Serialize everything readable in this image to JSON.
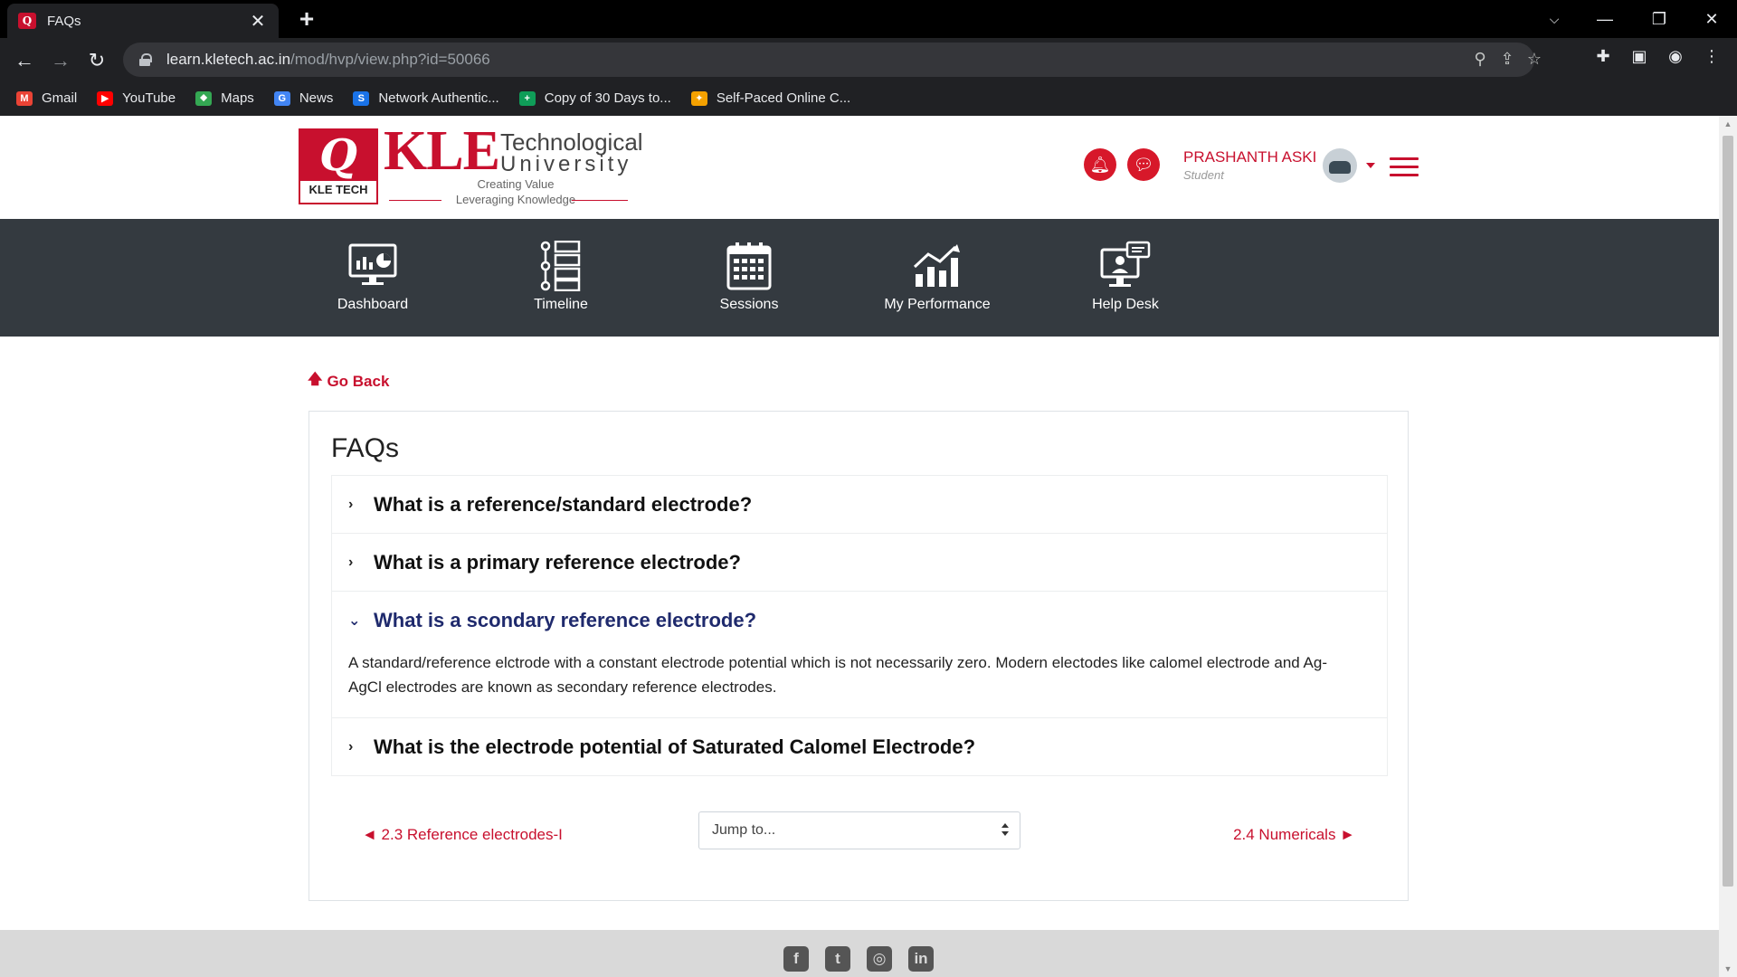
{
  "browser": {
    "tab_title": "FAQs",
    "tab_close": "✕",
    "new_tab": "+",
    "url_host": "learn.kletech.ac.in",
    "url_path": "/mod/hvp/view.php?id=50066",
    "bookmarks": [
      {
        "label": "Gmail",
        "icon": "gmail-icon",
        "color": "#ea4335"
      },
      {
        "label": "YouTube",
        "icon": "youtube-icon",
        "color": "#ff0000"
      },
      {
        "label": "Maps",
        "icon": "maps-icon",
        "color": "#34a853"
      },
      {
        "label": "News",
        "icon": "news-icon",
        "color": "#4285f4"
      },
      {
        "label": "Network Authentic...",
        "icon": "network-icon",
        "color": "#1a73e8"
      },
      {
        "label": "Copy of 30 Days to...",
        "icon": "sheets-icon",
        "color": "#0f9d58"
      },
      {
        "label": "Self-Paced Online C...",
        "icon": "course-icon",
        "color": "#f4a100"
      }
    ]
  },
  "header": {
    "logo_kle": "KLE",
    "logo_word1": "Technological",
    "logo_word2": "University",
    "logo_tag1": "Creating Value",
    "logo_tag2": "Leveraging Knowledge",
    "logo_badge": "KLE TECH",
    "user_name": "PRASHANTH ASKI",
    "user_role": "Student",
    "accent_color": "#c8102e"
  },
  "nav": {
    "items": [
      {
        "label": "Dashboard",
        "icon": "dashboard-icon"
      },
      {
        "label": "Timeline",
        "icon": "timeline-icon"
      },
      {
        "label": "Sessions",
        "icon": "calendar-icon"
      },
      {
        "label": "My Performance",
        "icon": "performance-chart-icon"
      },
      {
        "label": "Help Desk",
        "icon": "helpdesk-icon"
      }
    ]
  },
  "content": {
    "go_back": "Go Back",
    "title": "FAQs",
    "faqs": [
      {
        "question": "What is a reference/standard electrode?",
        "open": false
      },
      {
        "question": "What is a primary reference electrode?",
        "open": false
      },
      {
        "question": "What is a scondary reference electrode?",
        "open": true,
        "answer": "A standard/reference elctrode with a constant electrode potential which is not necessarily zero. Modern electodes like calomel electrode and Ag-AgCl electrodes are known as secondary reference electrodes."
      },
      {
        "question": "What is the electrode potential of Saturated Calomel Electrode?",
        "open": false
      }
    ],
    "prev_link": "◄ 2.3 Reference electrodes-I",
    "next_link": "2.4 Numericals ►",
    "jump_placeholder": "Jump to..."
  },
  "footer": {
    "social": [
      "facebook-icon",
      "twitter-icon",
      "instagram-icon",
      "linkedin-icon"
    ]
  }
}
